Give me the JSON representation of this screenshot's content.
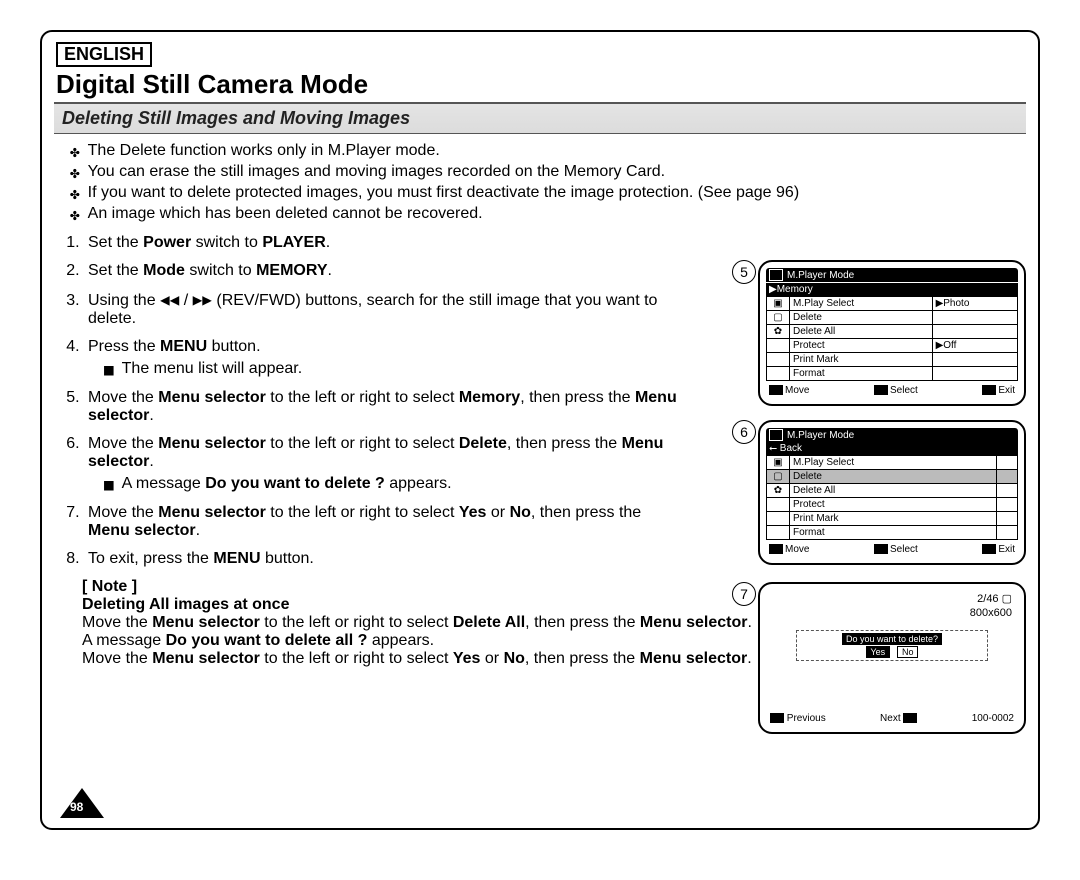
{
  "lang": "ENGLISH",
  "title": "Digital Still Camera Mode",
  "section": "Deleting Still Images and Moving Images",
  "intro": [
    "The Delete function works only in M.Player mode.",
    "You can erase the still images and moving images recorded on the Memory Card.",
    "If you want to delete protected images, you must first deactivate the image protection. (See page 96)",
    "An image which has been deleted cannot be recovered."
  ],
  "steps": {
    "s1a": "Set the ",
    "s1b": "Power",
    "s1c": " switch to ",
    "s1d": "PLAYER",
    "s1e": ".",
    "s2a": "Set the ",
    "s2b": "Mode",
    "s2c": " switch to ",
    "s2d": "MEMORY",
    "s2e": ".",
    "s3a": "Using the ",
    "s3rev": "◀◀",
    "s3slash": " / ",
    "s3fwd": "▶▶",
    "s3b": " (REV/FWD) buttons, search for the still image that you want to delete.",
    "s4a": "Press the ",
    "s4b": "MENU",
    "s4c": " button.",
    "s4sub": "The menu list will appear.",
    "s5a": "Move the ",
    "s5b": "Menu selector",
    "s5c": " to the left or right to select ",
    "s5d": "Memory",
    "s5e": ", then press the ",
    "s5f": "Menu selector",
    "s5g": ".",
    "s6a": "Move the ",
    "s6b": "Menu selector",
    "s6c": " to the left or right to select ",
    "s6d": "Delete",
    "s6e": ", then press the ",
    "s6f": "Menu selector",
    "s6g": ".",
    "s6sub_a": "A message ",
    "s6sub_b": "Do you want to delete ?",
    "s6sub_c": " appears.",
    "s7a": "Move the ",
    "s7b": "Menu selector",
    "s7c": " to the left or right to select ",
    "s7d": "Yes",
    "s7e": " or ",
    "s7f": "No",
    "s7g": ", then press the ",
    "s7h": "Menu selector",
    "s7i": ".",
    "s8a": "To exit, press the ",
    "s8b": "MENU",
    "s8c": " button."
  },
  "note": {
    "label": "[ Note ]",
    "heading": "Deleting All images at once",
    "l1a": "Move the ",
    "l1b": "Menu selector",
    "l1c": " to the left or right to select ",
    "l1d": "Delete All",
    "l1e": ", then press the ",
    "l1f": "Menu selector",
    "l1g": ".",
    "l2a": "A message ",
    "l2b": "Do you want to delete all ?",
    "l2c": " appears.",
    "l3a": "Move the ",
    "l3b": "Menu selector",
    "l3c": " to the left or right to select ",
    "l3d": "Yes",
    "l3e": " or ",
    "l3f": "No",
    "l3g": ", then press the ",
    "l3h": "Menu selector",
    "l3i": "."
  },
  "page_num": "98",
  "screens": {
    "s5": {
      "num": "5",
      "title": "M.Player Mode",
      "sub": "▶Memory",
      "rows": [
        {
          "icon": "▣",
          "label": "M.Play Select",
          "val": "▶Photo"
        },
        {
          "icon": "▢",
          "label": "Delete",
          "val": ""
        },
        {
          "icon": "✿",
          "label": "Delete All",
          "val": ""
        },
        {
          "icon": "",
          "label": "Protect",
          "val": "▶Off"
        },
        {
          "icon": "",
          "label": "Print Mark",
          "val": ""
        },
        {
          "icon": "",
          "label": "Format",
          "val": ""
        }
      ],
      "foot": {
        "a": "Move",
        "b": "Select",
        "c": "Exit"
      }
    },
    "s6": {
      "num": "6",
      "title": "M.Player Mode",
      "sub": "⭠ Back",
      "rows": [
        {
          "icon": "▣",
          "label": "M.Play Select",
          "val": "",
          "sel": false
        },
        {
          "icon": "▢",
          "label": "Delete",
          "val": "",
          "sel": true
        },
        {
          "icon": "✿",
          "label": "Delete All",
          "val": "",
          "sel": false
        },
        {
          "icon": "",
          "label": "Protect",
          "val": "",
          "sel": false
        },
        {
          "icon": "",
          "label": "Print Mark",
          "val": "",
          "sel": false
        },
        {
          "icon": "",
          "label": "Format",
          "val": "",
          "sel": false
        }
      ],
      "foot": {
        "a": "Move",
        "b": "Select",
        "c": "Exit"
      }
    },
    "s7": {
      "num": "7",
      "counter": "2/46 ▢",
      "res": "800x600",
      "prompt": "Do you want to delete?",
      "yes": "Yes",
      "no": "No",
      "prev": "Previous",
      "next": "Next",
      "id": "100-0002"
    }
  }
}
